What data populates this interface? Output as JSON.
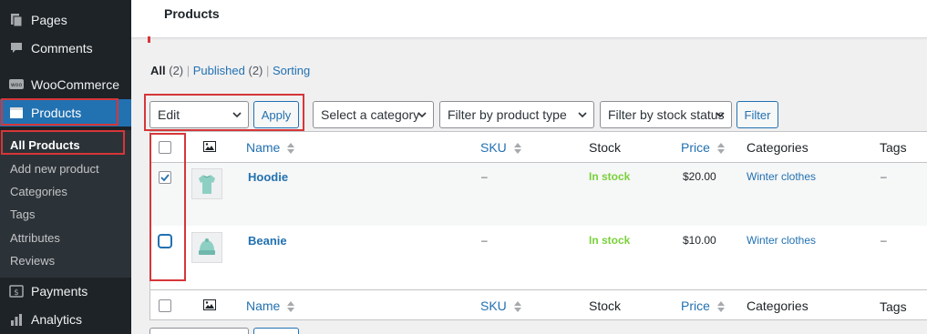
{
  "sidebar": {
    "items": [
      {
        "label": "Pages",
        "icon": "pages-icon"
      },
      {
        "label": "Comments",
        "icon": "comments-icon"
      },
      {
        "label": "WooCommerce",
        "icon": "woo-icon"
      },
      {
        "label": "Products",
        "icon": "products-icon"
      },
      {
        "label": "Payments",
        "icon": "payments-icon"
      },
      {
        "label": "Analytics",
        "icon": "analytics-icon"
      }
    ],
    "submenu": [
      "All Products",
      "Add new product",
      "Categories",
      "Tags",
      "Attributes",
      "Reviews"
    ]
  },
  "header": {
    "title": "Products"
  },
  "views": {
    "all": "All",
    "all_count": "(2)",
    "published": "Published",
    "published_count": "(2)",
    "sorting": "Sorting"
  },
  "toolbar": {
    "bulk_action": "Edit",
    "apply": "Apply",
    "category": "Select a category",
    "product_type": "Filter by product type",
    "stock_status": "Filter by stock status",
    "filter": "Filter"
  },
  "table": {
    "columns": {
      "name": "Name",
      "sku": "SKU",
      "stock": "Stock",
      "price": "Price",
      "categories": "Categories",
      "tags": "Tags"
    },
    "rows": [
      {
        "name": "Hoodie",
        "sku": "–",
        "stock": "In stock",
        "price": "$20.00",
        "categories": "Winter clothes",
        "tags": "–",
        "checked": true
      },
      {
        "name": "Beanie",
        "sku": "–",
        "stock": "In stock",
        "price": "$10.00",
        "categories": "Winter clothes",
        "tags": "–",
        "checked": false
      }
    ]
  },
  "colors": {
    "accent": "#2271b1",
    "sidebar": "#1d2327",
    "highlight": "#d63638",
    "in_stock": "#7ad03a"
  }
}
